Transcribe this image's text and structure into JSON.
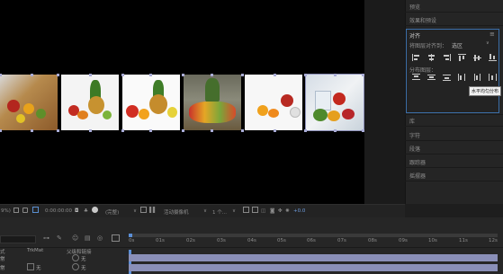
{
  "panel": {
    "preview": "预览",
    "effects": "效果和预设",
    "align_title": "对齐",
    "align_to_label": "将图层对齐到：",
    "align_to_value": "选区",
    "distribute_label": "分布图层：",
    "tooltip": "水平均匀分布",
    "library": "库",
    "character": "字符",
    "paragraph": "段落",
    "tracker": "跟踪器",
    "wiggler": "摇摆器"
  },
  "viewer_toolbar": {
    "zoom": "9%)",
    "timecode": "0:00:00:00",
    "resolution": "(完整)",
    "camera": "活动摄像机",
    "views": "1 个...",
    "exposure": "+0.0"
  },
  "timeline": {
    "ticks": [
      "0s",
      "01s",
      "02s",
      "03s",
      "04s",
      "05s",
      "06s",
      "07s",
      "08s",
      "09s",
      "10s",
      "11s",
      "12s"
    ],
    "col_trkmat": "TrkMat",
    "col_parent": "父级和链接",
    "mode_col": "式",
    "rows": [
      {
        "mode": "常",
        "trkmat": "",
        "parent": "无"
      },
      {
        "mode": "常",
        "trkmat": "无",
        "parent": "无"
      }
    ]
  },
  "colors": {
    "accent": "#3b6ea8",
    "track": "#8a8fb8",
    "playhead": "#5b8fd6"
  }
}
